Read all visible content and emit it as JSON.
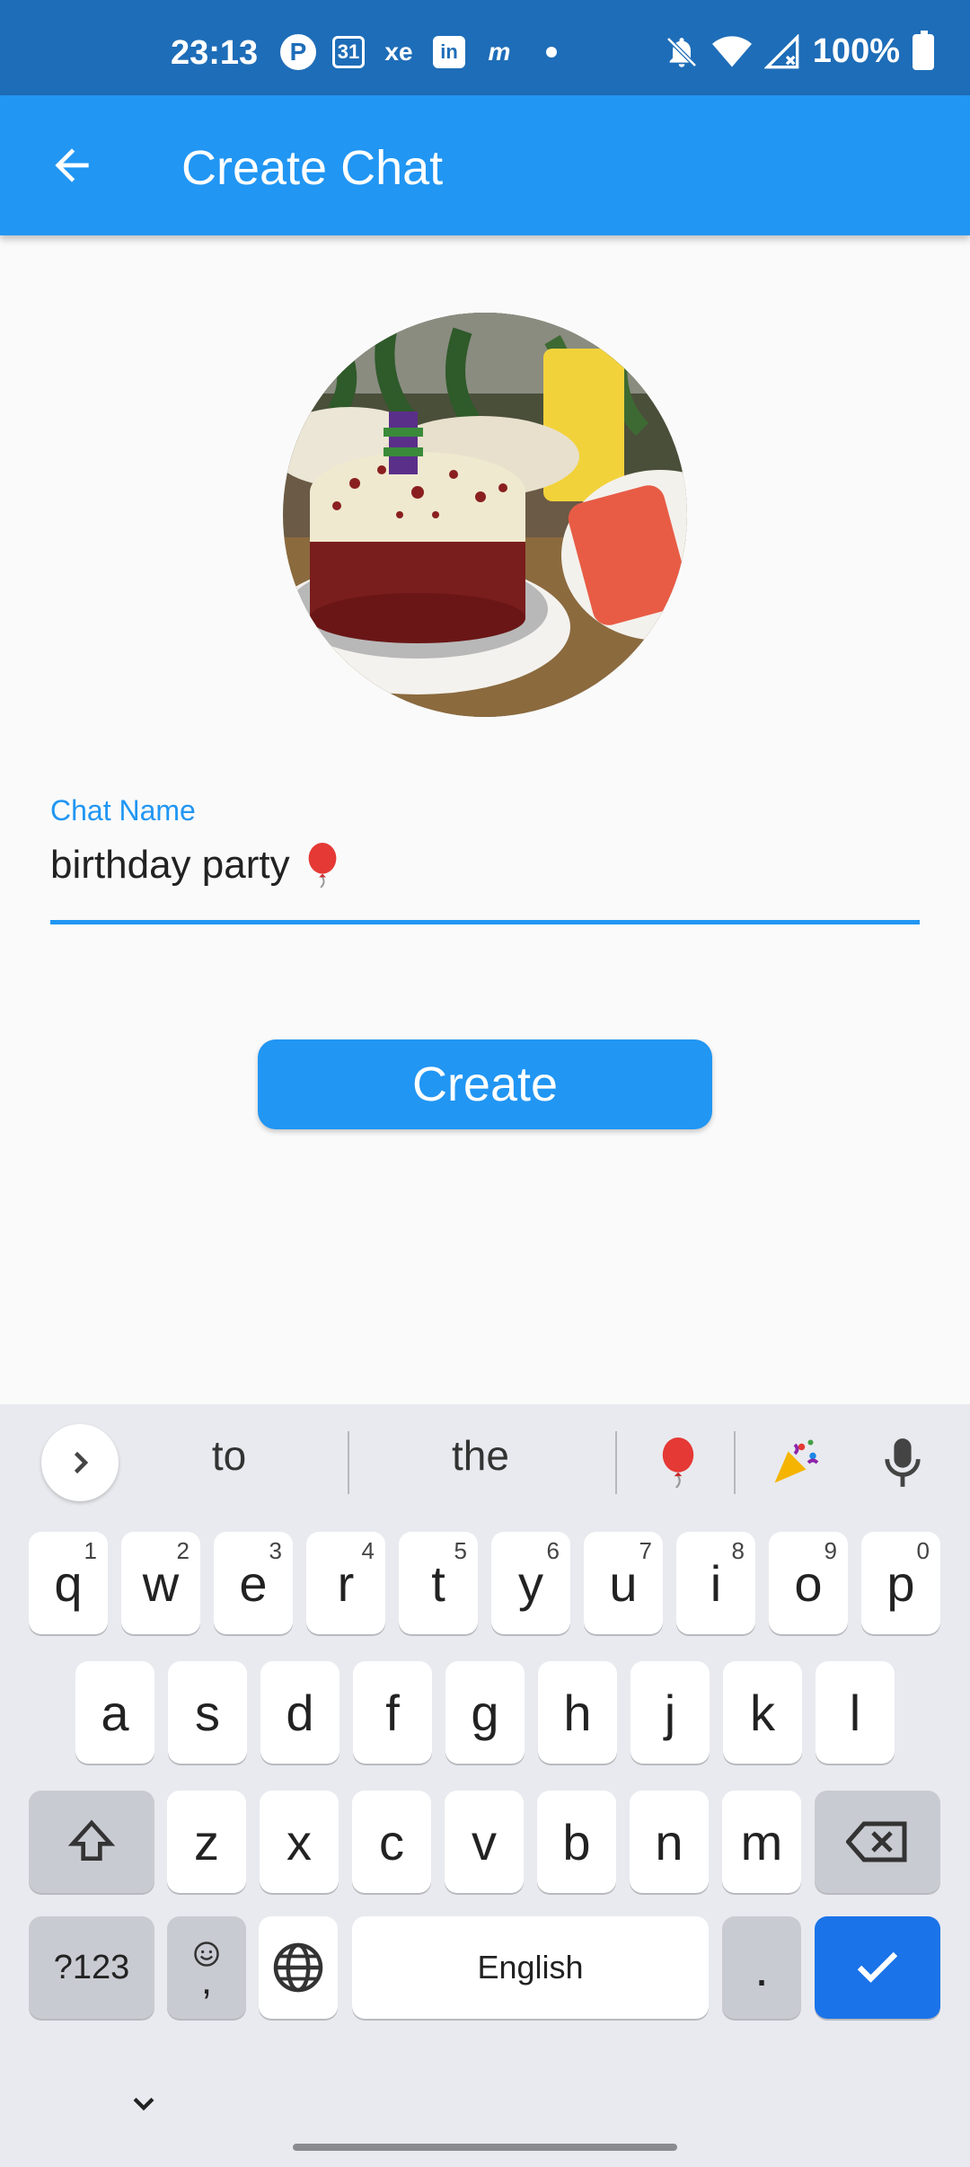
{
  "status_bar": {
    "time": "23:13",
    "calendar_day": "31",
    "xe_label": "xe",
    "linkedin_label": "in",
    "m_label": "m",
    "battery": "100%"
  },
  "app_bar": {
    "title": "Create Chat"
  },
  "form": {
    "chat_name_label": "Chat Name",
    "chat_name_value": "birthday party",
    "create_label": "Create"
  },
  "keyboard": {
    "suggestions": [
      "to",
      "the"
    ],
    "row1": [
      {
        "k": "q",
        "h": "1"
      },
      {
        "k": "w",
        "h": "2"
      },
      {
        "k": "e",
        "h": "3"
      },
      {
        "k": "r",
        "h": "4"
      },
      {
        "k": "t",
        "h": "5"
      },
      {
        "k": "y",
        "h": "6"
      },
      {
        "k": "u",
        "h": "7"
      },
      {
        "k": "i",
        "h": "8"
      },
      {
        "k": "o",
        "h": "9"
      },
      {
        "k": "p",
        "h": "0"
      }
    ],
    "row2": [
      "a",
      "s",
      "d",
      "f",
      "g",
      "h",
      "j",
      "k",
      "l"
    ],
    "row3": [
      "z",
      "x",
      "c",
      "v",
      "b",
      "n",
      "m"
    ],
    "symbols_label": "?123",
    "emoji_comma": ",",
    "space_label": "English",
    "period_label": "."
  },
  "colors": {
    "primary": "#2196f3",
    "status_bar": "#1e6db8",
    "enter_key": "#1a73e8"
  }
}
